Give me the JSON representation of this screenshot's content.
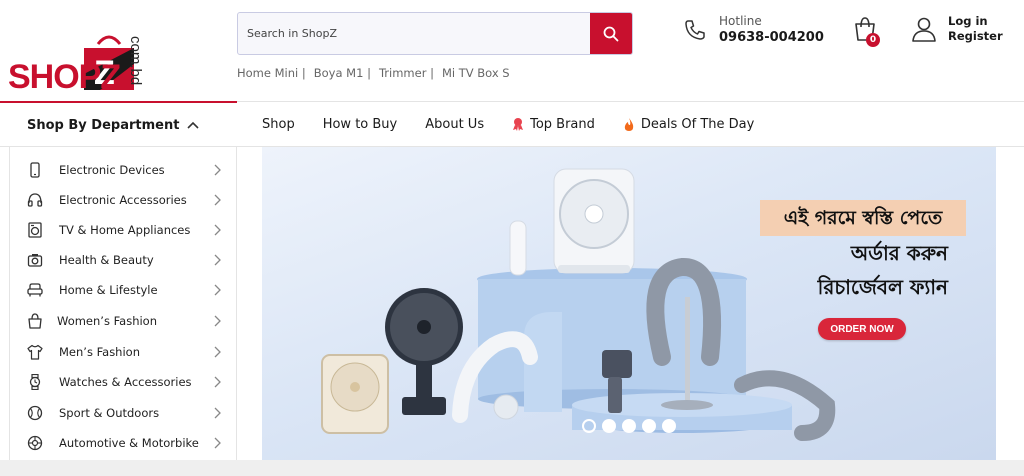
{
  "brand": {
    "logo_text": "SHOPZ",
    "logo_domain": "com.bd",
    "accent_color": "#c8102e"
  },
  "search": {
    "placeholder": "Search in ShopZ",
    "button_icon": "search-icon"
  },
  "quick_links": [
    "Home Mini |",
    "Boya M1 |",
    "Trimmer |",
    "Mi TV Box S"
  ],
  "hotline": {
    "label": "Hotline",
    "number": "09638-004200",
    "icon": "phone-icon"
  },
  "cart": {
    "count": "0",
    "icon": "shopping-bag-icon"
  },
  "account": {
    "login_label": "Log in",
    "register_label": "Register",
    "icon": "user-icon"
  },
  "nav": {
    "department_label": "Shop By Department",
    "menu": [
      {
        "label": "Shop",
        "icon": ""
      },
      {
        "label": "How to Buy",
        "icon": ""
      },
      {
        "label": "About Us",
        "icon": ""
      },
      {
        "label": "Top Brand",
        "icon": "badge-icon"
      },
      {
        "label": "Deals Of The Day",
        "icon": "flame-icon"
      }
    ]
  },
  "categories": [
    {
      "label": "Electronic Devices",
      "icon": "phone-device-icon"
    },
    {
      "label": "Electronic Accessories",
      "icon": "headphones-icon"
    },
    {
      "label": "TV & Home Appliances",
      "icon": "washing-machine-icon"
    },
    {
      "label": "Health & Beauty",
      "icon": "camera-icon"
    },
    {
      "label": "Home & Lifestyle",
      "icon": "sofa-icon"
    },
    {
      "label": "Women’s Fashion",
      "icon": "handbag-icon"
    },
    {
      "label": "Men’s Fashion",
      "icon": "tshirt-icon"
    },
    {
      "label": "Watches & Accessories",
      "icon": "watch-icon"
    },
    {
      "label": "Sport & Outdoors",
      "icon": "ball-icon"
    },
    {
      "label": "Automotive & Motorbike",
      "icon": "wheel-icon"
    }
  ],
  "banner": {
    "headline_line1": "এই গরমে স্বস্তি পেতে",
    "headline_line2": "অর্ডার করুন",
    "headline_line3": "রিচার্জেবল ফ্যান",
    "cta_label": "ORDER NOW",
    "slides": 5,
    "active_slide": 1
  }
}
